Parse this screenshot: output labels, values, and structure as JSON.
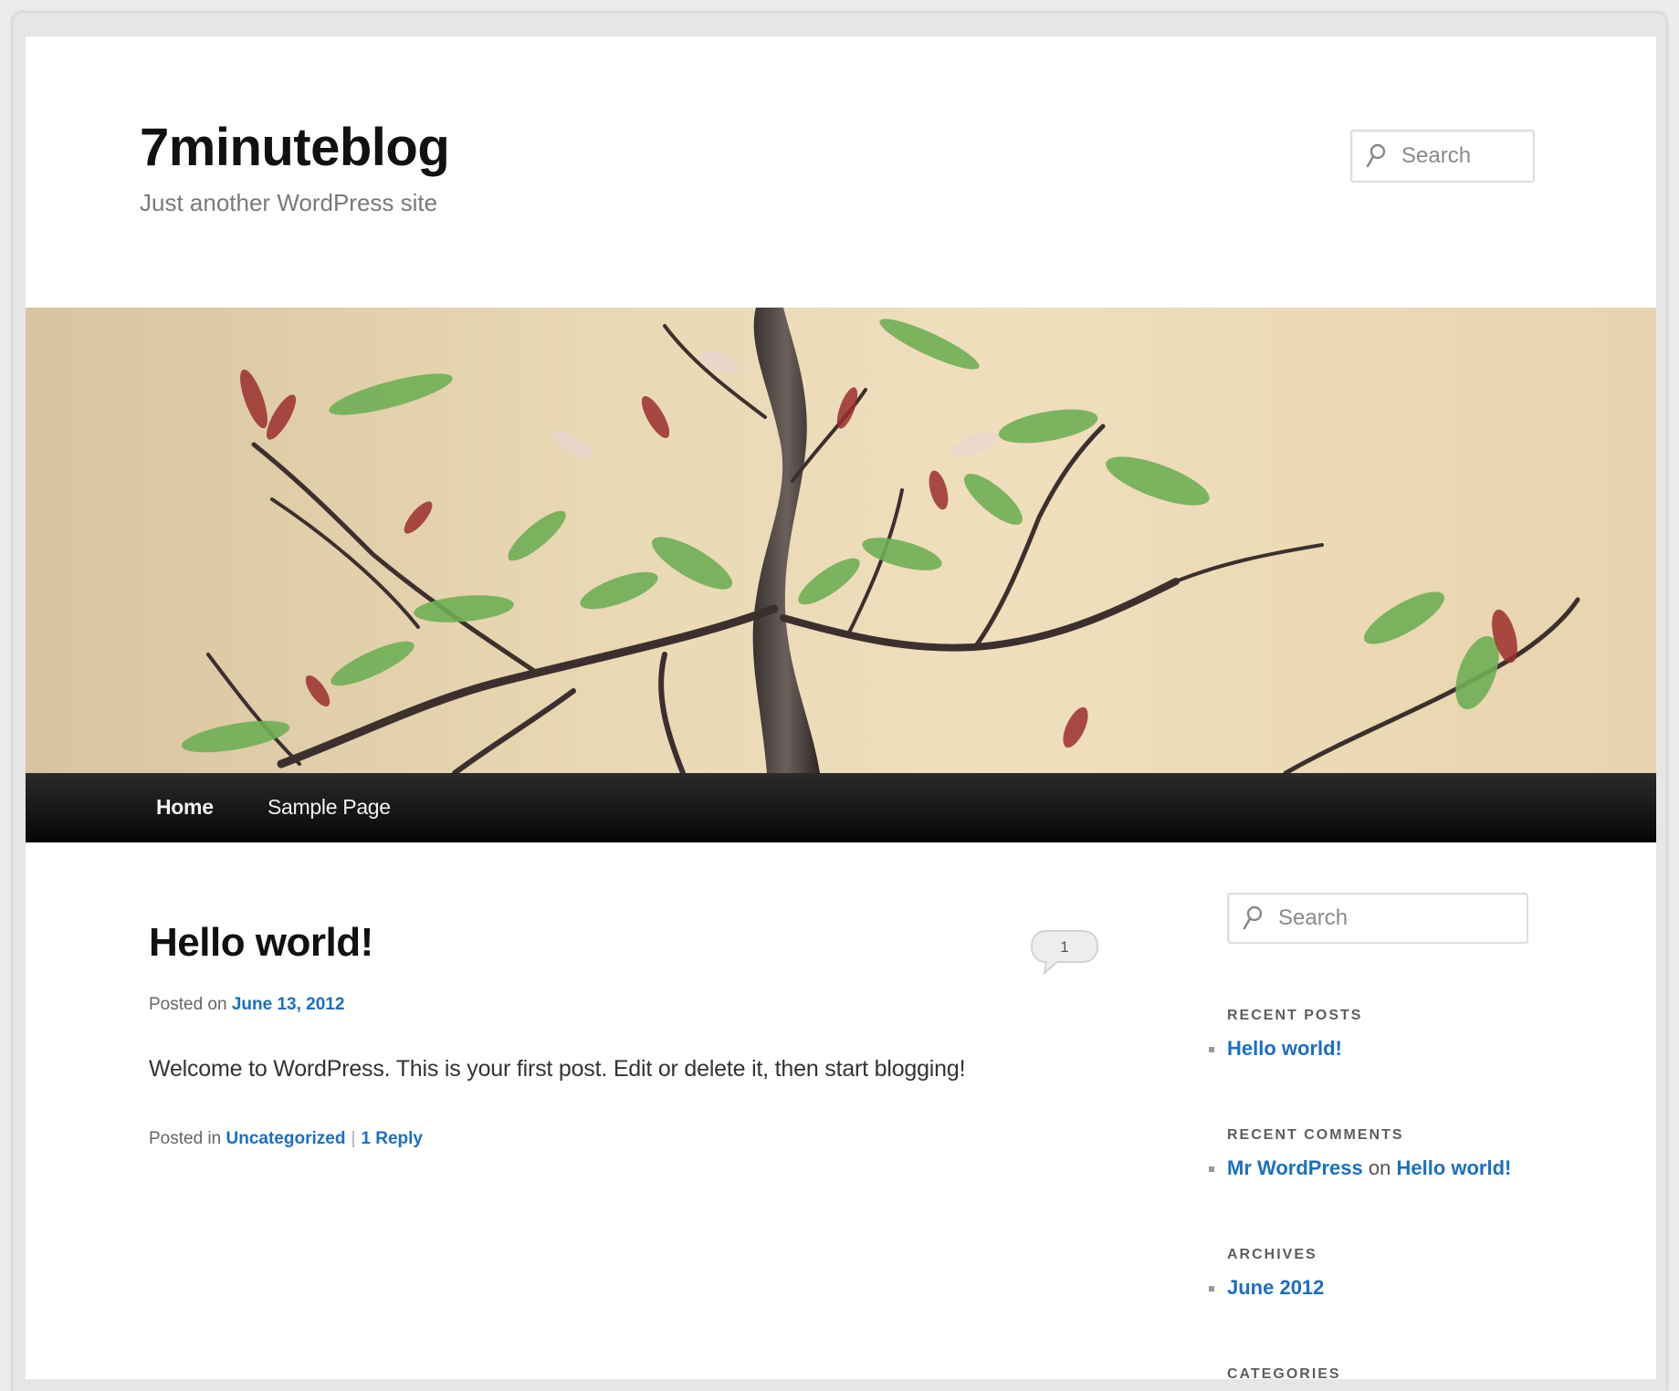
{
  "site": {
    "title": "7minuteblog",
    "description": "Just another WordPress site"
  },
  "header_search": {
    "placeholder": "Search"
  },
  "nav": {
    "items": [
      {
        "label": "Home",
        "active": true
      },
      {
        "label": "Sample Page",
        "active": false
      }
    ]
  },
  "post": {
    "title": "Hello world!",
    "comment_count": "1",
    "meta_prefix": "Posted on",
    "date": "June 13, 2012",
    "content": "Welcome to WordPress. This is your first post. Edit or delete it, then start blogging!",
    "footer_prefix": "Posted in",
    "category": "Uncategorized",
    "separator": "|",
    "reply_link": "1 Reply"
  },
  "sidebar": {
    "search_placeholder": "Search",
    "recent_posts": {
      "title": "RECENT POSTS",
      "items": [
        "Hello world!"
      ]
    },
    "recent_comments": {
      "title": "RECENT COMMENTS",
      "author": "Mr WordPress",
      "joiner": "on",
      "post": "Hello world!"
    },
    "archives": {
      "title": "ARCHIVES",
      "items": [
        "June 2012"
      ]
    },
    "categories": {
      "title": "CATEGORIES"
    }
  },
  "colors": {
    "link": "#1b6fc2",
    "nav_bg": "#111111",
    "title": "#111111"
  }
}
